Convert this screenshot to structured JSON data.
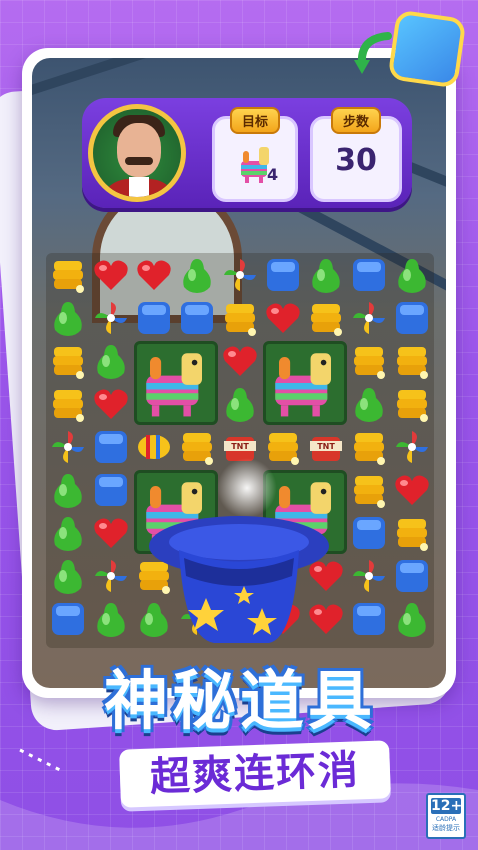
{
  "hud": {
    "goal_label": "目标",
    "goal_count": "4",
    "goal_icon": "pinata-icon",
    "moves_label": "步数",
    "moves_value": "30"
  },
  "board": {
    "rows": [
      [
        "candle",
        "heart",
        "heart",
        "pear",
        "pinwheel",
        "cube",
        "pear",
        "cube",
        "pear"
      ],
      [
        "pear",
        "pinwheel",
        "cube",
        "cube",
        "candle",
        "heart",
        "candle",
        "pinwheel",
        "cube"
      ],
      [
        "candle",
        "pear",
        "pinata",
        "pinata",
        "heart",
        "pinata",
        "pinata",
        "candle",
        "candle"
      ],
      [
        "candle",
        "heart",
        "pinata",
        "pinata",
        "pear",
        "pinata",
        "pinata",
        "pear",
        "candle"
      ],
      [
        "pinwheel",
        "cube",
        "striped",
        "candle",
        "tnt",
        "candle",
        "tnt",
        "candle",
        "pinwheel"
      ],
      [
        "pear",
        "cube",
        "pinata",
        "pinata",
        "hat",
        "pinata",
        "pinata",
        "candle",
        "heart"
      ],
      [
        "pear",
        "heart",
        "pinata",
        "pinata",
        "hat",
        "hat",
        "pinata",
        "cube",
        "candle"
      ],
      [
        "pear",
        "pinwheel",
        "candle",
        "hat",
        "hat",
        "hat",
        "heart",
        "pinwheel",
        "cube"
      ],
      [
        "cube",
        "pear",
        "pear",
        "pinwheel",
        "pinwheel",
        "heart",
        "heart",
        "cube",
        "pear"
      ]
    ],
    "tnt_label": "TNT"
  },
  "title": {
    "main": "神秘道具",
    "sub": "超爽连环消"
  },
  "age_rating": {
    "number": "12+",
    "org": "CADPA",
    "tip": "适龄提示"
  },
  "colors": {
    "background": "#9a55ea",
    "hud": "#6a2fcc",
    "title_outline": "#2e6fd8",
    "subtitle_text": "#6b2bd6",
    "heart": "#e0222b",
    "pear": "#3cb832",
    "cube": "#2f6fe0",
    "candle": "#f6c21a"
  }
}
